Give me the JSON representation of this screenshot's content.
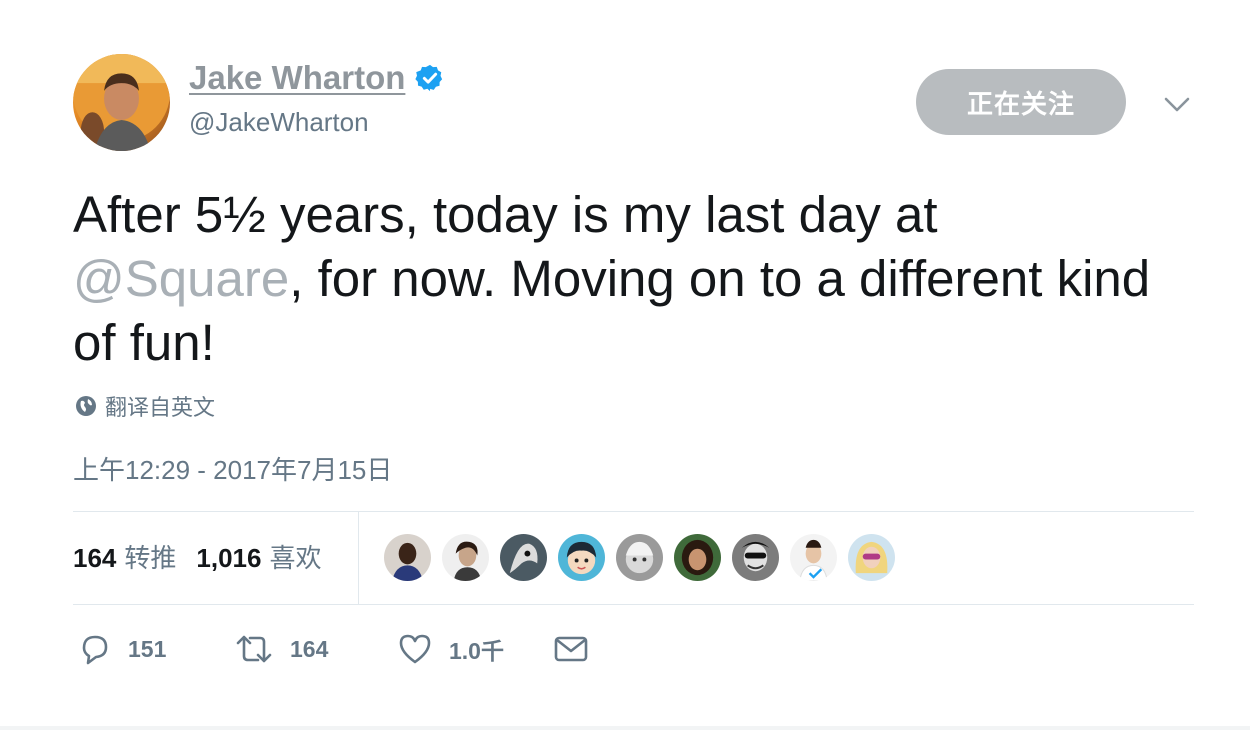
{
  "user": {
    "display_name": "Jake Wharton",
    "handle": "@JakeWharton",
    "verified_icon": "verified-badge-icon",
    "accent_color": "#1da1f2"
  },
  "header": {
    "follow_label": "正在关注",
    "menu_icon": "chevron-down-icon"
  },
  "tweet": {
    "text_part1": "After 5½ years, today is my last day at",
    "mention": "@Square",
    "text_part2": ", for now. Moving on to a different kind of fun!",
    "translate_label": "翻译自英文",
    "translate_icon": "globe-icon",
    "timestamp": "上午12:29 - 2017年7月15日"
  },
  "stats": {
    "retweet_count": "164",
    "retweet_label": "转推",
    "like_count": "1,016",
    "like_label": "喜欢"
  },
  "actions": {
    "reply_count": "151",
    "retweet_count": "164",
    "like_count": "1.0千",
    "reply_icon": "reply-icon",
    "retweet_icon": "retweet-icon",
    "like_icon": "heart-icon",
    "message_icon": "envelope-icon"
  }
}
